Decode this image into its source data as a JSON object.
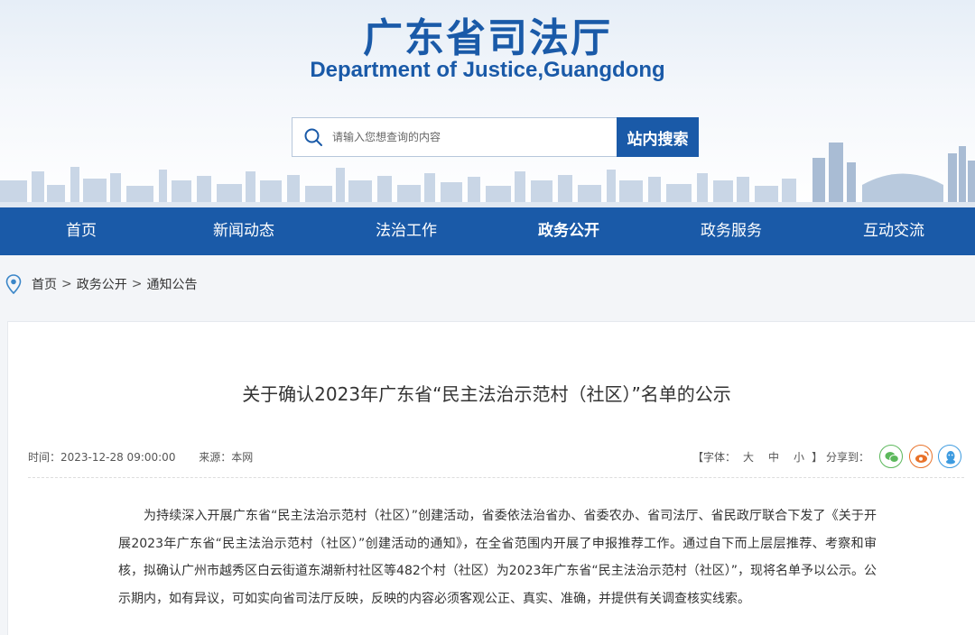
{
  "header": {
    "title_cn": "广东省司法厅",
    "title_en": "Department of Justice,Guangdong"
  },
  "search": {
    "placeholder": "请输入您想查询的内容",
    "button_label": "站内搜索"
  },
  "nav": {
    "items": [
      {
        "label": "首页"
      },
      {
        "label": "新闻动态"
      },
      {
        "label": "法治工作"
      },
      {
        "label": "政务公开",
        "active": true
      },
      {
        "label": "政务服务"
      },
      {
        "label": "互动交流"
      }
    ]
  },
  "breadcrumb": {
    "items": [
      "首页",
      "政务公开",
      "通知公告"
    ],
    "separator": ">"
  },
  "article": {
    "title": "关于确认2023年广东省“民主法治示范村（社区）”名单的公示",
    "time": "时间：2023-12-28 09:00:00",
    "source": "来源：本网",
    "font_size": {
      "prefix": "【字体：",
      "options": [
        "大",
        "中",
        "小"
      ],
      "suffix": "】"
    },
    "share_label": "分享到：",
    "share_icons": [
      "wechat-icon",
      "weibo-icon",
      "qq-icon"
    ],
    "body": "为持续深入开展广东省“民主法治示范村（社区）”创建活动，省委依法治省办、省委农办、省司法厅、省民政厅联合下发了《关于开展2023年广东省“民主法治示范村（社区）”创建活动的通知》，在全省范围内开展了申报推荐工作。通过自下而上层层推荐、考察和审核，拟确认广州市越秀区白云街道东湖新村社区等482个村（社区）为2023年广东省“民主法治示范村（社区）”，现将名单予以公示。公示期内，如有异议，可如实向省司法厅反映，反映的内容必须客观公正、真实、准确，并提供有关调查核实线索。"
  },
  "colors": {
    "brand_blue": "#1a5aa8",
    "wechat_green": "#5cb85c",
    "weibo_orange": "#e8722a",
    "qq_blue": "#3d9be0"
  }
}
